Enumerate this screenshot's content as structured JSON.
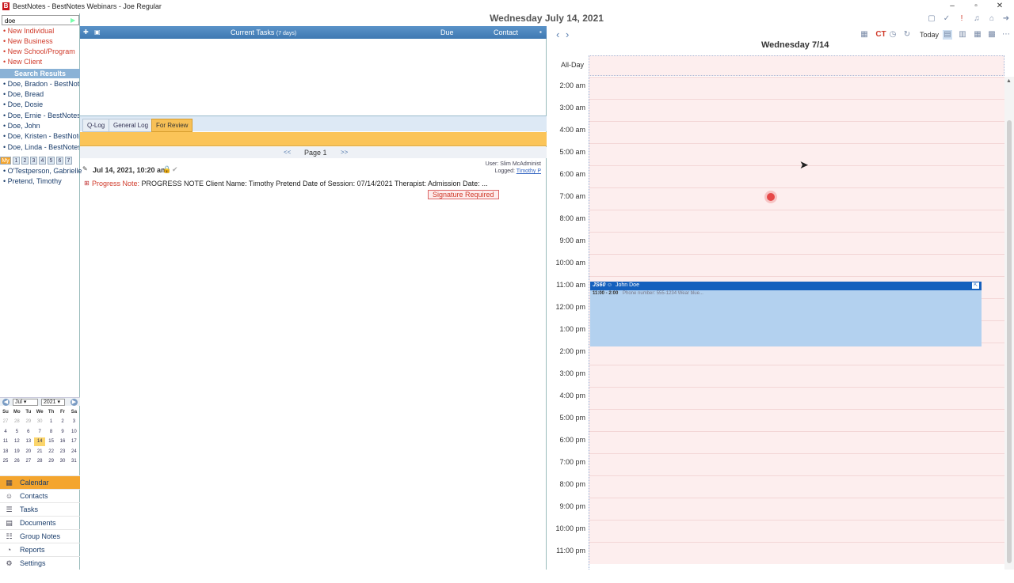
{
  "window": {
    "title": "BestNotes - BestNotes Webinars - Joe Regular",
    "logo": "B",
    "date_heading": "Wednesday July 14, 2021",
    "controls": [
      "minimize-icon",
      "restore-icon",
      "close-icon"
    ]
  },
  "toolbar": {
    "calendar_ct": "CT",
    "today": "Today"
  },
  "sidebar": {
    "search_value": "doe",
    "new_links": [
      "New Individual",
      "New Business",
      "New School/Program",
      "New Client"
    ],
    "search_results_header": "Search Results",
    "results": [
      "Doe, Bradon - BestNotes",
      "Doe, Bread",
      "Doe, Dosie",
      "Doe, Ernie - BestNotes",
      "Doe, John",
      "Doe, Kristen - BestNotes",
      "Doe, Linda - BestNotes"
    ],
    "my_tabs": [
      "My",
      "1",
      "2",
      "3",
      "4",
      "5",
      "6",
      "7"
    ],
    "my_items": [
      "O'Testperson, Gabrielle",
      "Pretend, Timothy"
    ]
  },
  "minical": {
    "month": "Jul",
    "year": "2021",
    "dow": [
      "Su",
      "Mo",
      "Tu",
      "We",
      "Th",
      "Fr",
      "Sa"
    ],
    "weeks": [
      [
        "27",
        "28",
        "29",
        "30",
        "1",
        "2",
        "3"
      ],
      [
        "4",
        "5",
        "6",
        "7",
        "8",
        "9",
        "10"
      ],
      [
        "11",
        "12",
        "13",
        "14",
        "15",
        "16",
        "17"
      ],
      [
        "18",
        "19",
        "20",
        "21",
        "22",
        "23",
        "24"
      ],
      [
        "25",
        "26",
        "27",
        "28",
        "29",
        "30",
        "31"
      ]
    ],
    "today": "14"
  },
  "nav": [
    "Calendar",
    "Contacts",
    "Tasks",
    "Documents",
    "Group Notes",
    "Reports",
    "Settings"
  ],
  "tasks": {
    "title": "Current Tasks",
    "count": "(7 days)",
    "col_due": "Due",
    "col_contact": "Contact"
  },
  "log_tabs": [
    "Q-Log",
    "General Log",
    "For Review"
  ],
  "pager": {
    "prev": "<<",
    "label": "Page 1",
    "next": ">>"
  },
  "entry": {
    "date": "Jul 14, 2021, 10:20 am",
    "user_label": "User:",
    "user": "Slim McAdminist",
    "logged_label": "Logged:",
    "logged": "Timothy P",
    "type": "Progress Note:",
    "text": "PROGRESS NOTE Client Name: Timothy Pretend Date of Session: 07/14/2021 Therapist: Admission Date: ...",
    "signature": "Signature Required"
  },
  "calendar": {
    "day_title": "Wednesday 7/14",
    "allday": "All-Day",
    "hours": [
      "2:00 am",
      "3:00 am",
      "4:00 am",
      "5:00 am",
      "6:00 am",
      "7:00 am",
      "8:00 am",
      "9:00 am",
      "10:00 am",
      "11:00 am",
      "12:00 pm",
      "1:00 pm",
      "2:00 pm",
      "3:00 pm",
      "4:00 pm",
      "5:00 pm",
      "6:00 pm",
      "7:00 pm",
      "8:00 pm",
      "9:00 pm",
      "10:00 pm",
      "11:00 pm"
    ],
    "appointment": {
      "code": "JS60",
      "name": "John Doe",
      "time": "11:00 - 2:00",
      "detail": "Phone number: 555-1234 Wear blue..."
    }
  }
}
